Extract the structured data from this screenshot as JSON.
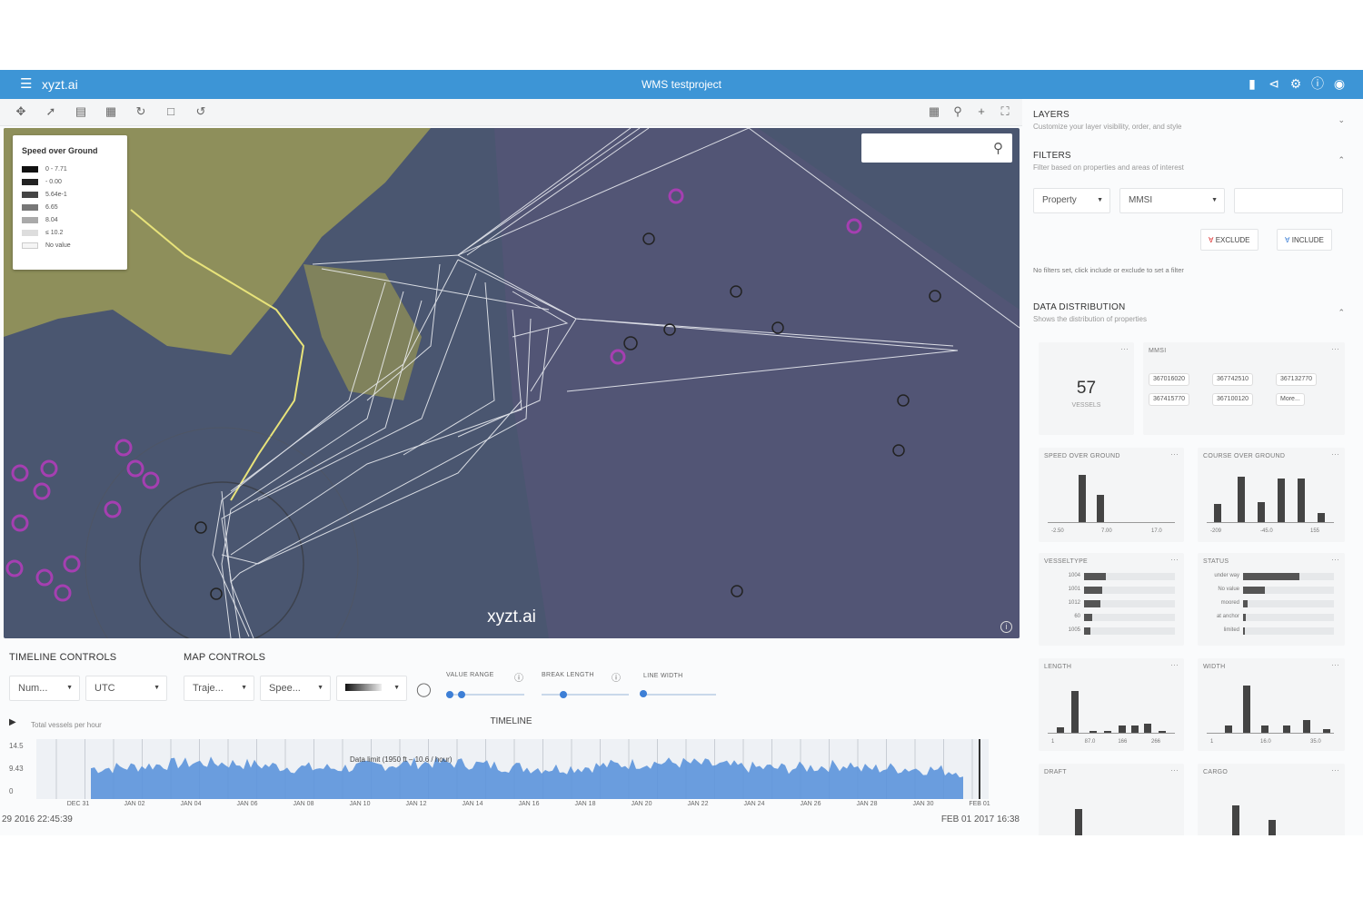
{
  "header": {
    "menu_icon": "hamburger-menu-icon",
    "brand": "xyzt.ai",
    "project_title": "WMS testproject",
    "icons": [
      "bookmark-icon",
      "share-icon",
      "settings-gear-icon",
      "help-icon",
      "account-icon"
    ]
  },
  "toolbar": {
    "left_icons": [
      "pan-icon",
      "select-icon",
      "filter-area-icon",
      "edit-area-icon",
      "refresh-icon",
      "crop-icon",
      "reset-icon"
    ],
    "right_icons": [
      "layers-grid-icon",
      "zoom-icon",
      "plus-icon",
      "fullscreen-icon"
    ]
  },
  "map": {
    "legend": {
      "title": "Speed over Ground",
      "items": [
        {
          "label": "0 - 7.71",
          "color": "#111111"
        },
        {
          "label": "- 0.00",
          "color": "#222222"
        },
        {
          "label": "5.64e-1",
          "color": "#444444"
        },
        {
          "label": "6.65",
          "color": "#777777"
        },
        {
          "label": "8.04",
          "color": "#aaaaaa"
        },
        {
          "label": "≤ 10.2",
          "color": "#dddddd"
        },
        {
          "label": "No value",
          "color": "#f5f5f5"
        }
      ]
    },
    "search_placeholder": "",
    "watermark": "xyzt.ai",
    "colors": {
      "water": "#48566e",
      "land": "#8f8f5c",
      "tracks": "#f2f4f8",
      "markers": "#a53fb1",
      "coast": "#e8e37a"
    }
  },
  "timeline_controls": {
    "title": "TIMELINE CONTROLS",
    "metric": "Num...",
    "timezone": "UTC"
  },
  "map_controls": {
    "title": "MAP CONTROLS",
    "mode": "Traje...",
    "property": "Spee...",
    "value_range_label": "VALUE RANGE",
    "break_length_label": "BREAK LENGTH",
    "line_width_label": "LINE WIDTH",
    "value_range": [
      0.05,
      0.2
    ],
    "break_length": 0.25,
    "line_width": 0.05
  },
  "timeline": {
    "play_icon": "play-icon",
    "series_label": "Total vessels per hour",
    "title": "TIMELINE",
    "hover_text": "Data limit (1950 ft – 10.6 / hour)",
    "y_ticks": [
      "14.5",
      "9.43",
      "0"
    ],
    "x_ticks": [
      "DEC 31",
      "JAN 02",
      "JAN 04",
      "JAN 06",
      "JAN 08",
      "JAN 10",
      "JAN 12",
      "JAN 14",
      "JAN 16",
      "JAN 18",
      "JAN 20",
      "JAN 22",
      "JAN 24",
      "JAN 26",
      "JAN 28",
      "JAN 30",
      "FEB 01"
    ],
    "start": "29 2016 22:45:39",
    "end": "FEB 01 2017 16:38",
    "fill": "#5b93dc"
  },
  "right_panel": {
    "layers": {
      "title": "LAYERS",
      "subtitle": "Customize your layer visibility, order, and style"
    },
    "filters": {
      "title": "FILTERS",
      "subtitle": "Filter based on properties and areas of interest",
      "property_select": "Property",
      "field_select": "MMSI",
      "value_input": "",
      "exclude_label": "EXCLUDE",
      "include_label": "INCLUDE",
      "empty_text": "No filters set, click include or exclude to set a filter"
    },
    "distribution": {
      "title": "DATA DISTRIBUTION",
      "subtitle": "Shows the distribution of properties",
      "vessels_count": "57",
      "vessels_label": "VESSELS",
      "mmsi_title": "MMSI",
      "mmsi_chips": [
        "367016020",
        "367742510",
        "367132770",
        "367415770",
        "367100120",
        "More..."
      ],
      "cards": [
        {
          "title": "SPEED OVER GROUND",
          "ticks": [
            "-2.50",
            "7.00",
            "17.0"
          ]
        },
        {
          "title": "COURSE OVER GROUND",
          "ticks": [
            "-209",
            "-45.0",
            "155"
          ]
        },
        {
          "title": "VESSELTYPE",
          "rows": [
            [
              "1004",
              0.24
            ],
            [
              "1001",
              0.2
            ],
            [
              "1012",
              0.18
            ],
            [
              "60",
              0.09
            ],
            [
              "1005",
              0.07
            ]
          ]
        },
        {
          "title": "STATUS",
          "rows": [
            [
              "under way",
              0.62
            ],
            [
              "No value",
              0.24
            ],
            [
              "moored",
              0.05
            ],
            [
              "at anchor",
              0.03
            ],
            [
              "limited",
              0.02
            ]
          ]
        },
        {
          "title": "LENGTH",
          "ticks": [
            "1",
            "87.0",
            "166",
            "266"
          ]
        },
        {
          "title": "WIDTH",
          "ticks": [
            "1",
            "16.0",
            "35.0"
          ]
        },
        {
          "title": "DRAFT",
          "ticks": []
        },
        {
          "title": "CARGO",
          "ticks": []
        }
      ]
    }
  }
}
